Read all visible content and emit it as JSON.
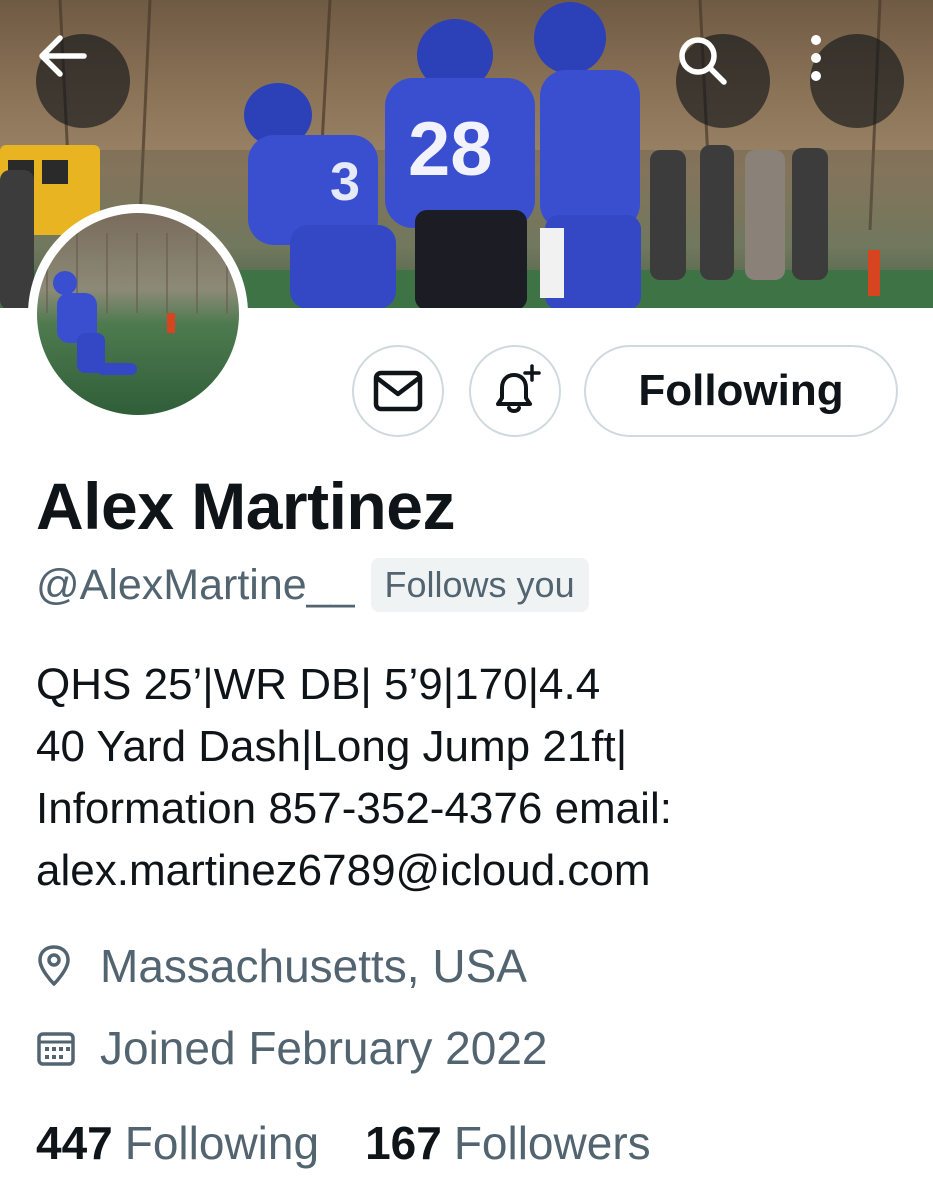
{
  "header": {
    "back_icon": "arrow-left-icon",
    "search_icon": "search-icon",
    "more_icon": "more-vertical-icon",
    "banner_jersey_number": "28"
  },
  "profile": {
    "display_name": "Alex Martinez",
    "handle": "@AlexMartine__",
    "follows_you_badge": "Follows you",
    "bio_lines": [
      "QHS 25’|WR DB| 5’9|170|4.4",
      "40 Yard Dash|Long Jump 21ft|",
      "Information 857-352-4376 email:",
      "alex.martinez6789@icloud.com"
    ],
    "location": "Massachusetts, USA",
    "joined": "Joined February 2022"
  },
  "actions": {
    "message_icon": "envelope-icon",
    "notify_icon": "bell-plus-icon",
    "following_label": "Following"
  },
  "stats": {
    "following_count": "447",
    "following_label": "Following",
    "followers_count": "167",
    "followers_label": "Followers"
  },
  "colors": {
    "text_primary": "#0f1419",
    "text_secondary": "#536471",
    "border": "#cfd9de",
    "badge_bg": "#eff3f4",
    "jersey_blue": "#3a4fd0"
  }
}
